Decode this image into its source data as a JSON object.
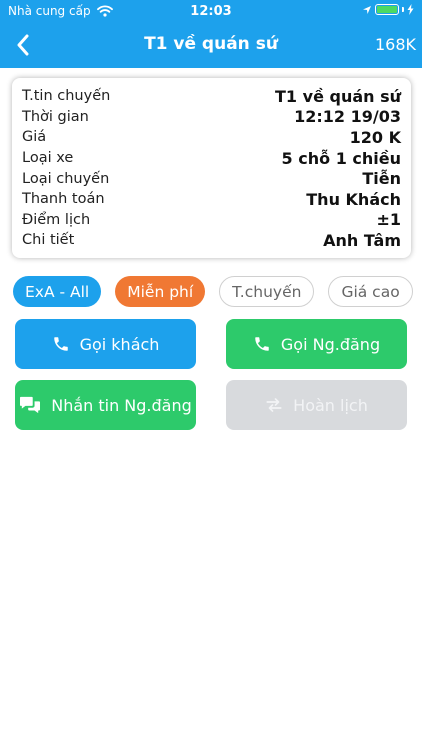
{
  "status_bar": {
    "carrier": "Nhà cung cấp",
    "time": "12:03"
  },
  "nav": {
    "title": "T1 về quán sứ",
    "right": "168K"
  },
  "trip": {
    "rows": [
      {
        "label": "T.tin chuyến",
        "value": "T1 về quán sứ"
      },
      {
        "label": "Thời gian",
        "value": "12:12 19/03"
      },
      {
        "label": "Giá",
        "value": "120 K"
      },
      {
        "label": "Loại xe",
        "value": "5 chỗ 1 chiều"
      },
      {
        "label": "Loại chuyến",
        "value": "Tiễn"
      },
      {
        "label": "Thanh toán",
        "value": "Thu Khách"
      },
      {
        "label": "Điểm lịch",
        "value": "±1"
      },
      {
        "label": "Chi tiết",
        "value": "Anh Tâm"
      }
    ]
  },
  "tags": [
    "ExA - All",
    "Miễn phí",
    "T.chuyến",
    "Giá cao"
  ],
  "actions": {
    "call_customer": "Gọi khách",
    "call_poster": "Gọi Ng.đăng",
    "message_poster": "Nhắn tin Ng.đăng",
    "cancel_booking": "Hoàn lịch"
  },
  "colors": {
    "primary": "#1da1ec",
    "green": "#2dca6b",
    "orange": "#f07833",
    "disabled": "#d8dadd"
  }
}
